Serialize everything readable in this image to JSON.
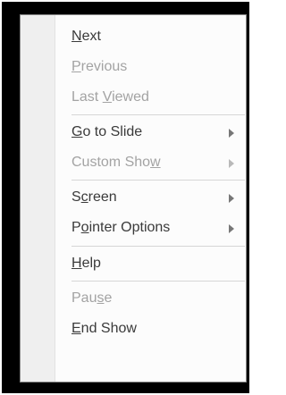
{
  "menu": {
    "items": [
      {
        "pre": "",
        "acc": "N",
        "post": "ext",
        "enabled": true,
        "submenu": false
      },
      {
        "pre": "",
        "acc": "P",
        "post": "revious",
        "enabled": false,
        "submenu": false
      },
      {
        "pre": "Last ",
        "acc": "V",
        "post": "iewed",
        "enabled": false,
        "submenu": false
      },
      {
        "pre": "",
        "acc": "G",
        "post": "o to Slide",
        "enabled": true,
        "submenu": true
      },
      {
        "pre": "Custom Sho",
        "acc": "w",
        "post": "",
        "enabled": false,
        "submenu": true
      },
      {
        "pre": "S",
        "acc": "c",
        "post": "reen",
        "enabled": true,
        "submenu": true
      },
      {
        "pre": "P",
        "acc": "o",
        "post": "inter Options",
        "enabled": true,
        "submenu": true
      },
      {
        "pre": "",
        "acc": "H",
        "post": "elp",
        "enabled": true,
        "submenu": false
      },
      {
        "pre": "Pau",
        "acc": "s",
        "post": "e",
        "enabled": false,
        "submenu": false
      },
      {
        "pre": "",
        "acc": "E",
        "post": "nd Show",
        "enabled": true,
        "submenu": false
      }
    ]
  },
  "colors": {
    "enabled_text": "#3a3a3a",
    "disabled_text": "#a3a3a3",
    "gutter": "#efefef",
    "frame": "#000000"
  }
}
